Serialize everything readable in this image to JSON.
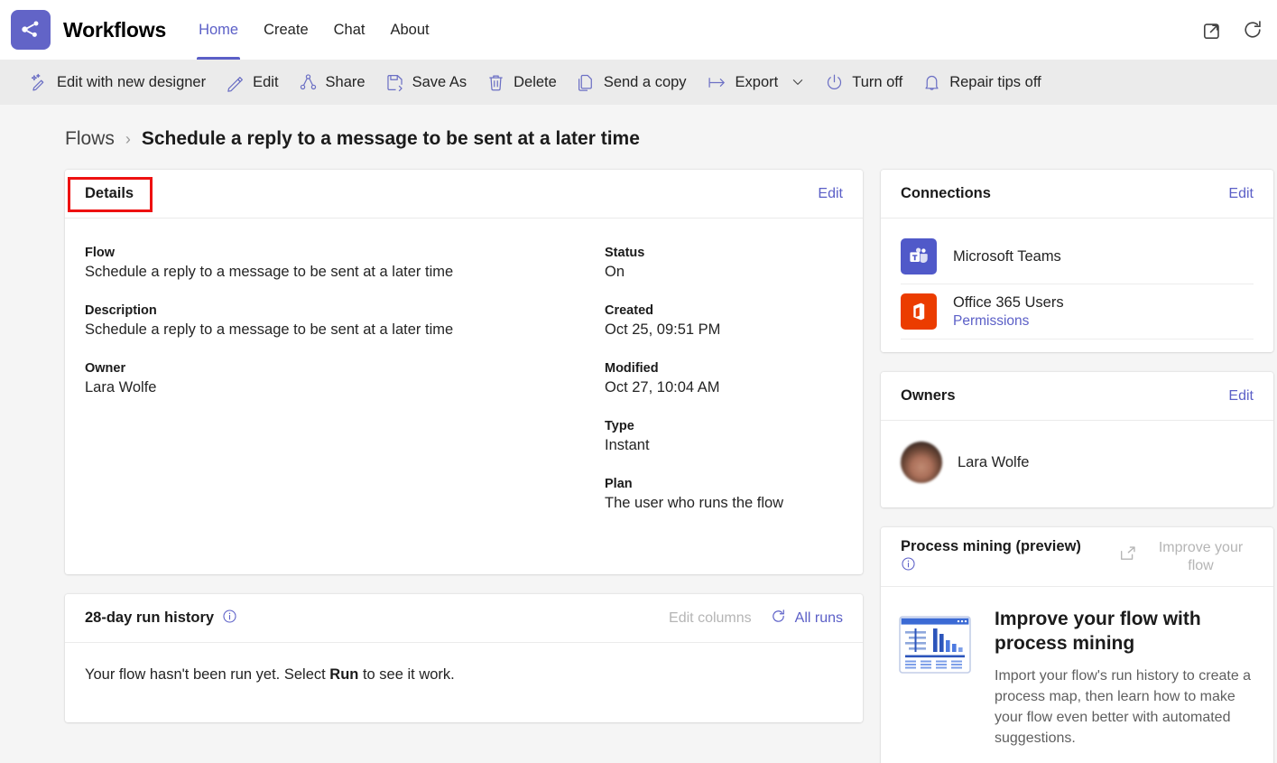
{
  "header": {
    "app_title": "Workflows",
    "logo_icon": "workflow-share-nodes-icon",
    "logo_color": "#6264c7",
    "nav": [
      {
        "label": "Home",
        "active": true
      },
      {
        "label": "Create",
        "active": false
      },
      {
        "label": "Chat",
        "active": false
      },
      {
        "label": "About",
        "active": false
      }
    ],
    "right_icons": [
      {
        "name": "pop-out-icon"
      },
      {
        "name": "refresh-icon"
      }
    ]
  },
  "command_bar": {
    "items": [
      {
        "label": "Edit with new designer",
        "icon": "magic-wand-edit-icon"
      },
      {
        "label": "Edit",
        "icon": "pencil-icon"
      },
      {
        "label": "Share",
        "icon": "share-icon"
      },
      {
        "label": "Save As",
        "icon": "save-as-icon"
      },
      {
        "label": "Delete",
        "icon": "trash-icon"
      },
      {
        "label": "Send a copy",
        "icon": "copy-icon"
      },
      {
        "label": "Export",
        "icon": "export-arrow-icon",
        "has_chevron": true
      },
      {
        "label": "Turn off",
        "icon": "power-icon"
      },
      {
        "label": "Repair tips off",
        "icon": "bell-icon"
      }
    ]
  },
  "breadcrumb": {
    "root": "Flows",
    "separator": "›",
    "current": "Schedule a reply to a message to be sent at a later time"
  },
  "details": {
    "title": "Details",
    "edit_label": "Edit",
    "highlight_color": "#ee1111",
    "left_fields": [
      {
        "label": "Flow",
        "value": "Schedule a reply to a message to be sent at a later time"
      },
      {
        "label": "Description",
        "value": "Schedule a reply to a message to be sent at a later time"
      },
      {
        "label": "Owner",
        "value": "Lara Wolfe"
      }
    ],
    "right_fields": [
      {
        "label": "Status",
        "value": "On"
      },
      {
        "label": "Created",
        "value": "Oct 25, 09:51 PM"
      },
      {
        "label": "Modified",
        "value": "Oct 27, 10:04 AM"
      },
      {
        "label": "Type",
        "value": "Instant"
      },
      {
        "label": "Plan",
        "value": "The user who runs the flow"
      }
    ]
  },
  "run_history": {
    "title": "28-day run history",
    "info_icon": "info-circle-icon",
    "edit_columns_label": "Edit columns",
    "all_runs_label": "All runs",
    "all_runs_icon": "refresh-icon",
    "empty_text_before": "Your flow hasn't been run yet. Select ",
    "empty_text_bold": "Run",
    "empty_text_after": " to see it work."
  },
  "connections": {
    "title": "Connections",
    "edit_label": "Edit",
    "items": [
      {
        "name": "Microsoft Teams",
        "sub": "",
        "icon": "microsoft-teams-icon",
        "color": "#5059c9"
      },
      {
        "name": "Office 365 Users",
        "sub": "Permissions",
        "icon": "office-365-icon",
        "color": "#eb3c00"
      }
    ]
  },
  "owners": {
    "title": "Owners",
    "edit_label": "Edit",
    "items": [
      {
        "name": "Lara Wolfe",
        "avatar": "user-photo-avatar"
      }
    ]
  },
  "process_mining": {
    "title": "Process mining (preview)",
    "info_icon": "info-circle-icon",
    "action_label": "Improve your flow",
    "action_icon": "open-in-new-window-icon",
    "illustration": "process-report-dashboard-icon",
    "heading": "Improve your flow with process mining",
    "text": "Import your flow's run history to create a process map, then learn how to make your flow even better with automated suggestions."
  },
  "colors": {
    "accent": "#5b5fc7",
    "page_bg": "#f5f5f5",
    "cmdbar_bg": "#ebebeb",
    "card_bg": "#ffffff"
  }
}
